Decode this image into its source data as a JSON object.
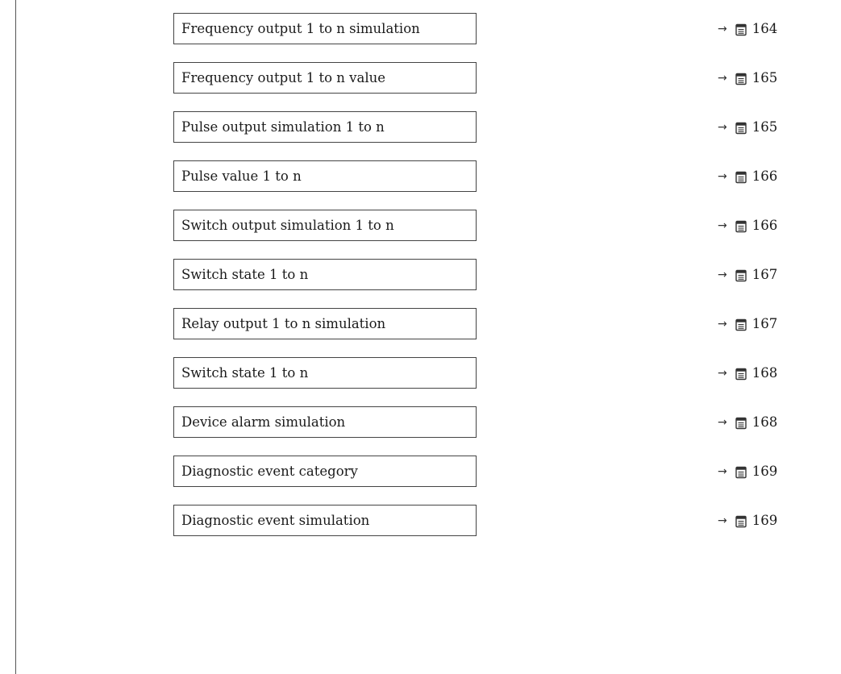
{
  "parameters": [
    {
      "label": "Frequency output 1 to n simulation",
      "page": "164"
    },
    {
      "label": "Frequency output 1 to n value",
      "page": "165"
    },
    {
      "label": "Pulse output simulation 1 to n",
      "page": "165"
    },
    {
      "label": "Pulse value 1 to n",
      "page": "166"
    },
    {
      "label": "Switch output simulation 1 to n",
      "page": "166"
    },
    {
      "label": "Switch state 1 to n",
      "page": "167"
    },
    {
      "label": "Relay output 1 to n simulation",
      "page": "167"
    },
    {
      "label": "Switch state 1 to n",
      "page": "168"
    },
    {
      "label": "Device alarm simulation",
      "page": "168"
    },
    {
      "label": "Diagnostic event category",
      "page": "169"
    },
    {
      "label": "Diagnostic event simulation",
      "page": "169"
    }
  ],
  "arrow_glyph": "→",
  "icons": {
    "arrow": "right-arrow-icon",
    "reference": "book-icon"
  }
}
